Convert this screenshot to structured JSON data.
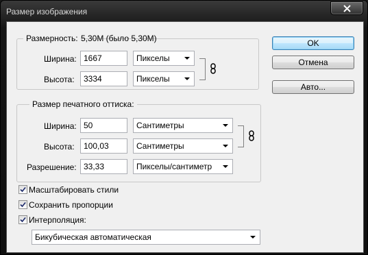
{
  "window": {
    "title": "Размер изображения"
  },
  "pixel_dimensions": {
    "legend_label": "Размерность:",
    "size_text": "5,30M (было 5,30M)",
    "width_label": "Ширина:",
    "width_value": "1667",
    "width_unit": "Пикселы",
    "height_label": "Высота:",
    "height_value": "3334",
    "height_unit": "Пикселы"
  },
  "document_size": {
    "legend_label": "Размер печатного оттиска:",
    "width_label": "Ширина:",
    "width_value": "50",
    "width_unit": "Сантиметры",
    "height_label": "Высота:",
    "height_value": "100,03",
    "height_unit": "Сантиметры",
    "resolution_label": "Разрешение:",
    "resolution_value": "33,33",
    "resolution_unit": "Пикселы/сантиметр"
  },
  "options": {
    "scale_styles": {
      "label": "Масштабировать стили",
      "checked": true
    },
    "constrain_proportions": {
      "label": "Сохранить пропорции",
      "checked": true
    },
    "resample": {
      "label": "Интерполяция:",
      "checked": true
    },
    "resample_method": "Бикубическая автоматическая"
  },
  "buttons": {
    "ok": "OK",
    "cancel": "Отмена",
    "auto": "Авто..."
  },
  "icons": {
    "close": "close-icon",
    "link": "chain-link-icon",
    "check": "checkmark-icon"
  }
}
